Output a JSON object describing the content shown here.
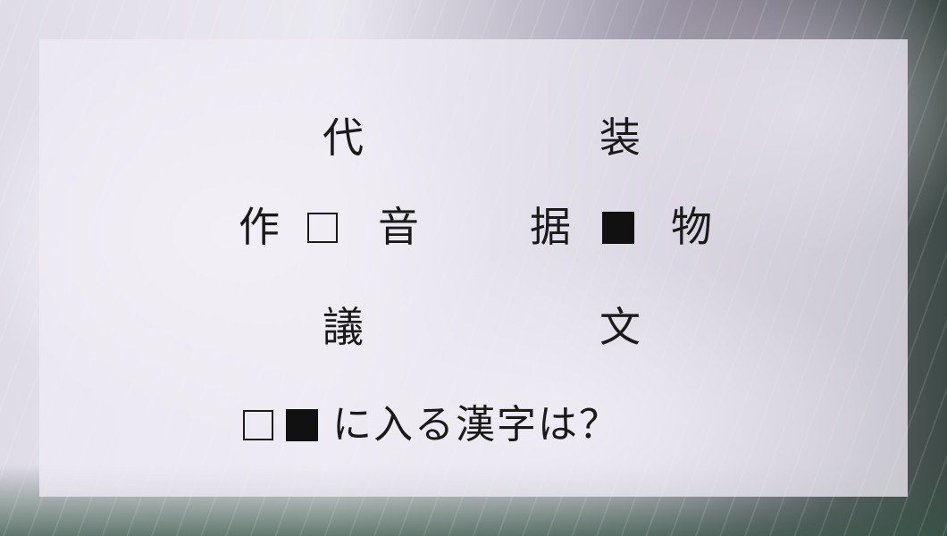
{
  "puzzle_left": {
    "top": "代",
    "left": "作",
    "right": "音",
    "bottom": "議"
  },
  "puzzle_right": {
    "top": "装",
    "left": "据",
    "right": "物",
    "bottom": "文"
  },
  "question_text": "に入る漢字は？"
}
